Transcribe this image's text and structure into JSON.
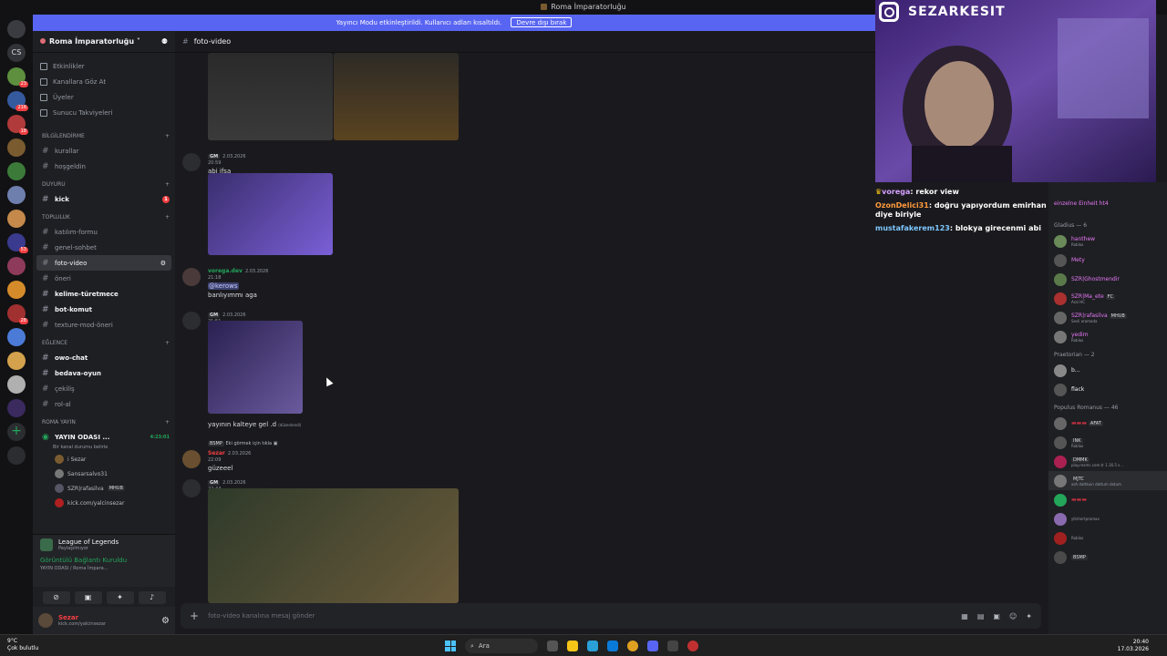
{
  "window": {
    "title": "Roma İmparatorluğu"
  },
  "banner": {
    "text": "Yayıncı Modu etkinleştirildi. Kullanıcı adları kısaltıldı.",
    "button": "Devre dışı bırak"
  },
  "rail": {
    "cs_label": "CS",
    "badges": [
      "23",
      "216",
      "18",
      "53",
      "28"
    ]
  },
  "server": {
    "name": "Roma İmparatorluğu"
  },
  "nav": [
    "Etkinlikler",
    "Kanallara Göz At",
    "Üyeler",
    "Sunucu Takviyeleri"
  ],
  "categories": {
    "bilgi": "BİLGİLENDİRME",
    "duyuru": "DUYURU",
    "topluluk": "TOPLULUK",
    "eglence": "EĞLENCE",
    "roma": "ROMA YAYIN"
  },
  "channels": {
    "kurallar": "kurallar",
    "hosgeldin": "hoşgeldin",
    "kick": "kick",
    "katilim": "katılım-formu",
    "sohbet": "genel-sohbet",
    "foto": "foto-video",
    "oneri": "öneri",
    "kelime": "kelime-türetmece",
    "bot": "bot-komut",
    "texture": "texture-mod-öneri",
    "owo": "owo-chat",
    "bedava": "bedava-oyun",
    "cekilis": "çekiliş",
    "rol": "rol-al",
    "yayin_odasi": "YAYIN ODASI ...",
    "yayin_time": "4:23:01",
    "yayin_status": "Bir kanal durumu belirle"
  },
  "voice_users": [
    {
      "name": "i Sezar"
    },
    {
      "name": "Sansarsalvo31"
    },
    {
      "name": "SZR|rafasilva",
      "tag": "MHUB"
    },
    {
      "name": "kick.com/yalcinsezar"
    }
  ],
  "activity": {
    "game": "League of Legends",
    "game_sub": "Paylaşılmıyor",
    "vc_status": "Görüntülü Bağlantı Kuruldu",
    "vc_sub": "YAYIN ODASI / Roma İmpara..."
  },
  "user": {
    "name": "Sezar",
    "sub": "kick.com/yalcinsezar"
  },
  "header": {
    "channel": "foto-video"
  },
  "messages": [
    {
      "time": "2.03.2026 20:59",
      "tag": "GM",
      "text": "abi ifşa"
    },
    {
      "name": "vorega.dev",
      "time": "2.03.2026 21:18",
      "mention": "@kerows",
      "text": "banlıyımmı aga"
    },
    {
      "time": "2.03.2026 21:51",
      "tag": "GM",
      "text": "yayının kalteye gel .d",
      "edited": "(düzenlendi)"
    },
    {
      "reply": "Eki görmek için tıkla",
      "reply_tag": "BSMP",
      "name": "Sezar",
      "time": "2.03.2026 22:09",
      "text": "güzeeel"
    },
    {
      "time": "2.03.2026 22:44",
      "tag": "GM"
    }
  ],
  "composer": {
    "placeholder": "foto-video kanalına mesaj gönder"
  },
  "stream": {
    "handle": "SEZARKESIT"
  },
  "stream_chat": [
    {
      "user": "vorega",
      "msg": "rekor view",
      "color": "#d4a0ff"
    },
    {
      "user": "OzonDelici31",
      "msg": "doğru yapıyordum emirhan diye biriyle",
      "color": "#ff9a3c"
    },
    {
      "user": "mustafakerem123",
      "msg": "blokya girecenmi abi",
      "color": "#7ec8ff"
    }
  ],
  "members": {
    "patricius_partial": "einzelne Einheit ht4",
    "gladius_header": "Gladius — 6",
    "gladius": [
      {
        "name": "hanthew",
        "sub": "Roblox",
        "color": "#e879f9"
      },
      {
        "name": "Mety",
        "sub": "",
        "color": "#e879f9"
      },
      {
        "name": "SZR|Ghostmendir",
        "sub": "",
        "color": "#e879f9"
      },
      {
        "name": "SZR|Ma_ete",
        "sub": "Assi HC",
        "color": "#e879f9",
        "tag": "FC"
      },
      {
        "name": "SZR|rafasilva",
        "sub": "Sesli aramada",
        "color": "#e879f9",
        "tag": "MHUB"
      },
      {
        "name": "yedim",
        "sub": "Roblox",
        "color": "#e879f9"
      }
    ],
    "praetor_header": "Praetorian — 2",
    "praetor": [
      {
        "name": "b..."
      },
      {
        "name": "flack"
      }
    ],
    "populus_header": "Populus Romanus — 46",
    "populus": [
      {
        "tag": "AFAT"
      },
      {
        "sub": "Roblox",
        "tag": "INK"
      },
      {
        "sub": "play.rexmc.com.tr 1.16.5 s...",
        "tag": "DMMK"
      },
      {
        "sub": "ash dattkuin dattum datum",
        "tag": "MJTC"
      },
      {
        "sub": ""
      },
      {
        "sub": "yt/shortpromax"
      },
      {
        "sub": "Roblox"
      },
      {
        "tag": "BSMP"
      },
      {
        "sub": ""
      }
    ]
  },
  "taskbar": {
    "weather_temp": "9°C",
    "weather_desc": "Çok bulutlu",
    "search": "Ara",
    "time": "20:40",
    "date": "17.03.2026"
  }
}
